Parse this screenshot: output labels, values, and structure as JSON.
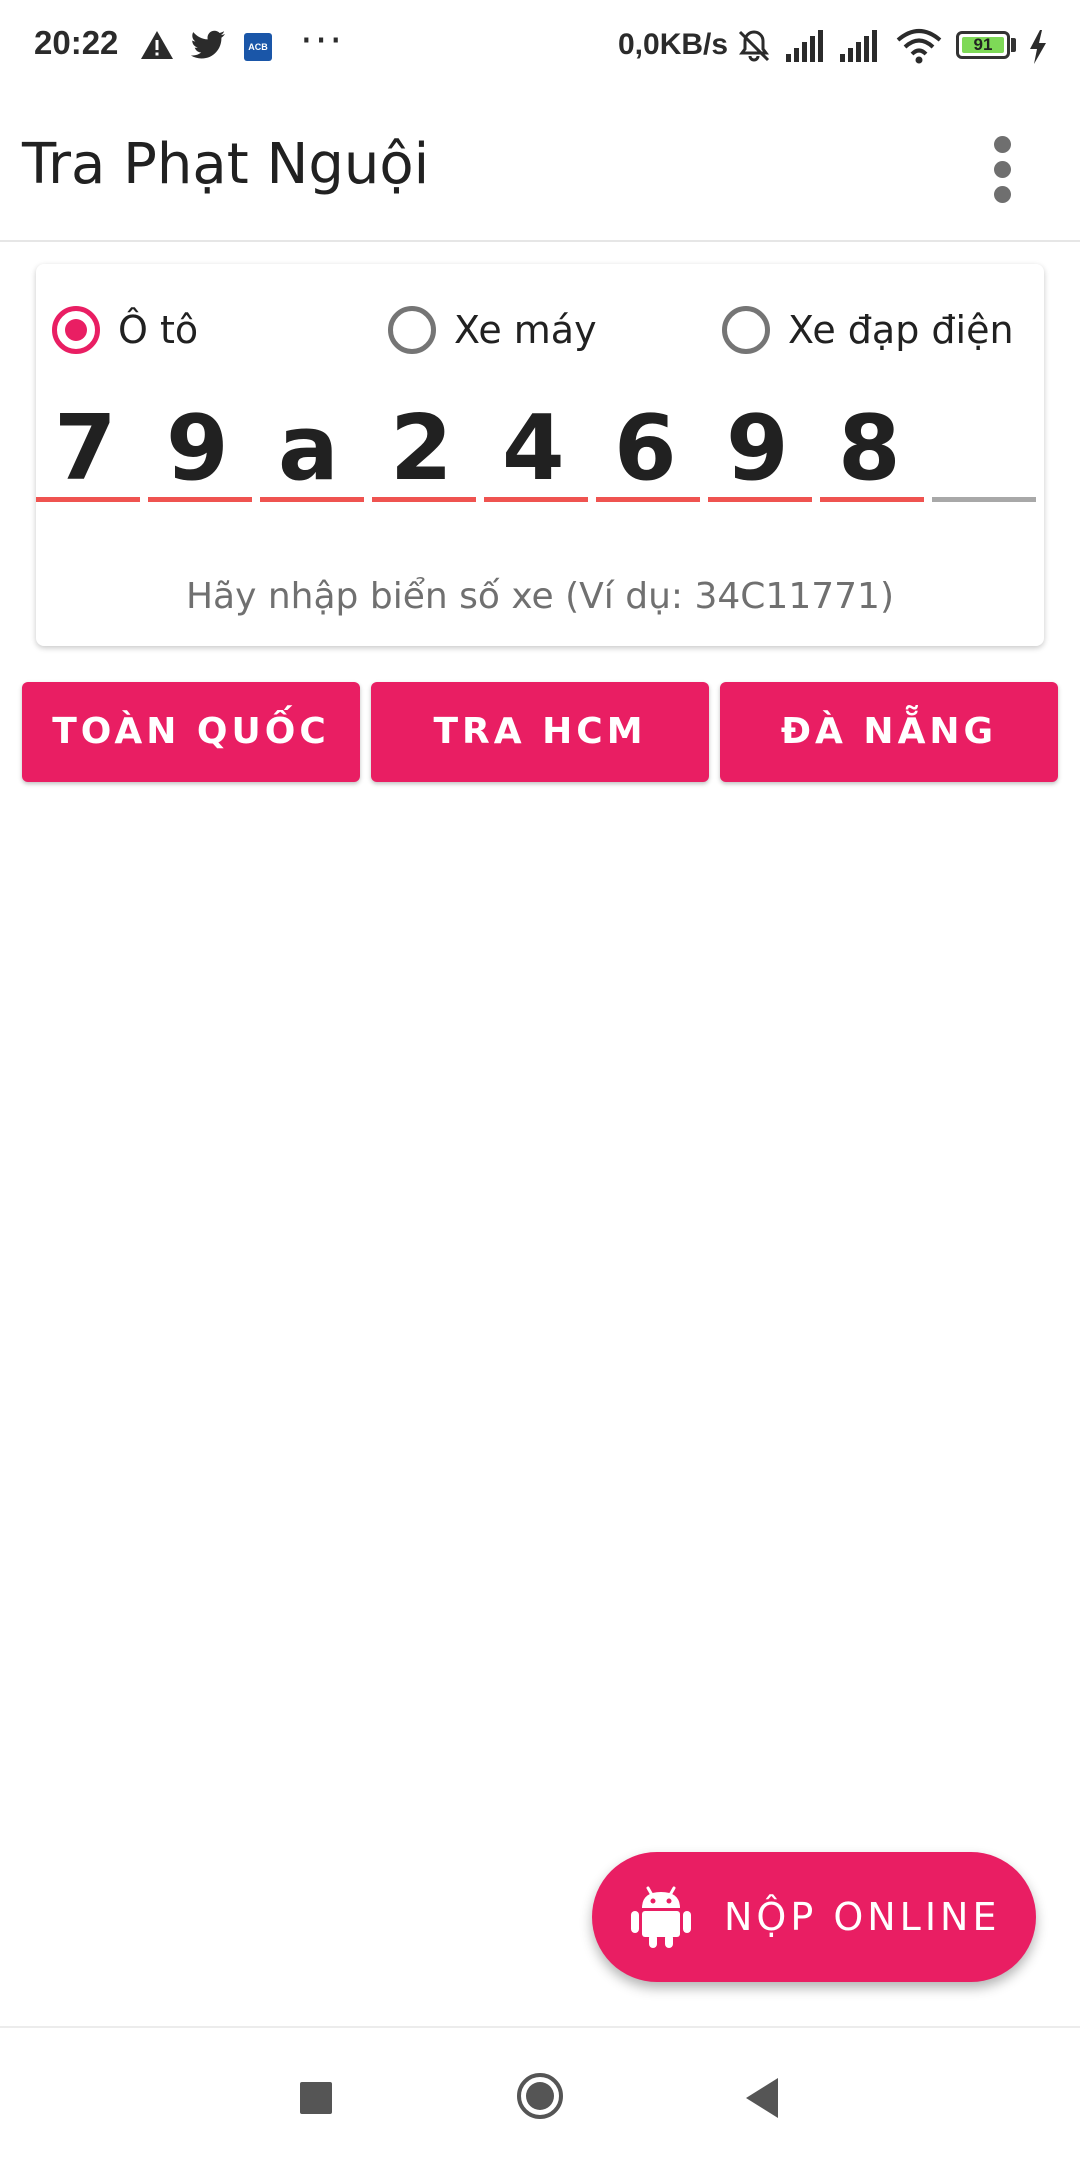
{
  "status_bar": {
    "time": "20:22",
    "net_speed": "0,0KB/s",
    "battery": "91",
    "notification_badge": "ACB",
    "more": "···"
  },
  "app_bar": {
    "title": "Tra Phạt Nguội",
    "overflow_icon": "more-vert-icon"
  },
  "vehicle_types": [
    {
      "label": "Ô tô",
      "checked": true
    },
    {
      "label": "Xe máy",
      "checked": false
    },
    {
      "label": "Xe đạp điện",
      "checked": false
    }
  ],
  "plate": {
    "chars": [
      "7",
      "9",
      "a",
      "2",
      "4",
      "6",
      "9",
      "8",
      ""
    ],
    "hint": "Hãy nhập biển số xe (Ví dụ: 34C11771)"
  },
  "actions": {
    "nationwide": "TOÀN QUỐC",
    "hcm": "TRA HCM",
    "danang": "ĐÀ NẴNG"
  },
  "fab": {
    "label": "NỘP ONLINE",
    "icon": "android-icon"
  },
  "colors": {
    "accent": "#e91e63",
    "underline_filled": "#ef5350",
    "underline_empty": "#a8a8a8"
  }
}
